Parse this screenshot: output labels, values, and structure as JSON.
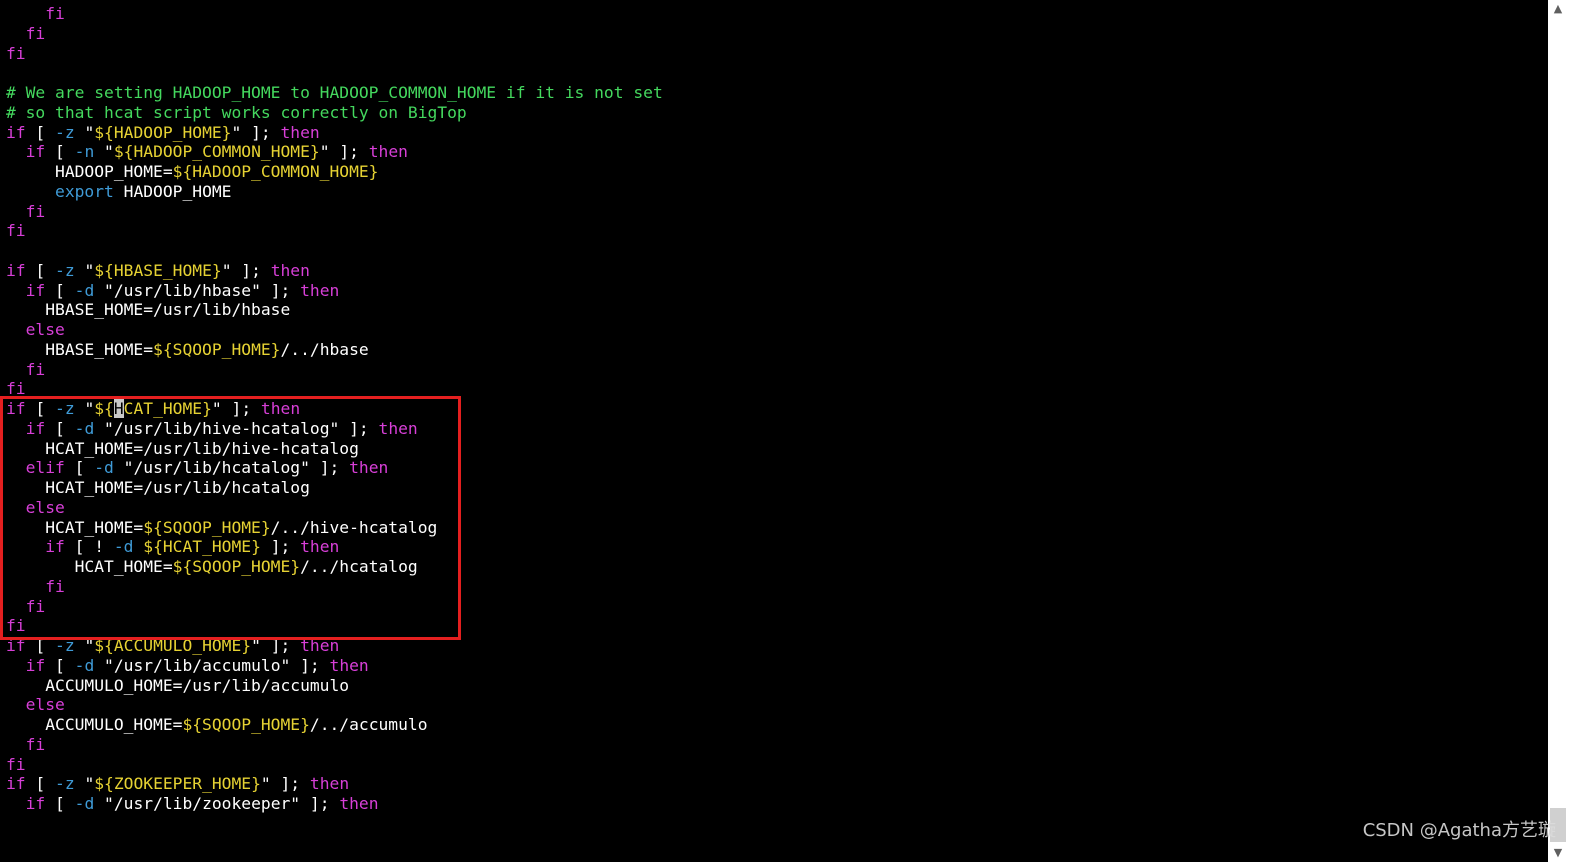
{
  "editor": {
    "lines": [
      [
        {
          "t": "    "
        },
        {
          "t": "fi",
          "c": "kw"
        }
      ],
      [
        {
          "t": "  "
        },
        {
          "t": "fi",
          "c": "kw"
        }
      ],
      [
        {
          "t": "fi",
          "c": "kw"
        }
      ],
      [],
      [
        {
          "t": "# We are setting HADOOP_HOME to HADOOP_COMMON_HOME if it is not set",
          "c": "cmt"
        }
      ],
      [
        {
          "t": "# so that hcat script works correctly on BigTop",
          "c": "cmt"
        }
      ],
      [
        {
          "t": "if",
          "c": "kw"
        },
        {
          "t": " [ "
        },
        {
          "t": "-z",
          "c": "cmd"
        },
        {
          "t": " \""
        },
        {
          "t": "${HADOOP_HOME}",
          "c": "var"
        },
        {
          "t": "\" ]; "
        },
        {
          "t": "then",
          "c": "kw"
        }
      ],
      [
        {
          "t": "  "
        },
        {
          "t": "if",
          "c": "kw"
        },
        {
          "t": " [ "
        },
        {
          "t": "-n",
          "c": "cmd"
        },
        {
          "t": " \""
        },
        {
          "t": "${HADOOP_COMMON_HOME}",
          "c": "var"
        },
        {
          "t": "\" ]; "
        },
        {
          "t": "then",
          "c": "kw"
        }
      ],
      [
        {
          "t": "     HADOOP_HOME="
        },
        {
          "t": "${HADOOP_COMMON_HOME}",
          "c": "var"
        }
      ],
      [
        {
          "t": "     "
        },
        {
          "t": "export",
          "c": "cmd"
        },
        {
          "t": " HADOOP_HOME"
        }
      ],
      [
        {
          "t": "  "
        },
        {
          "t": "fi",
          "c": "kw"
        }
      ],
      [
        {
          "t": "fi",
          "c": "kw"
        }
      ],
      [],
      [
        {
          "t": "if",
          "c": "kw"
        },
        {
          "t": " [ "
        },
        {
          "t": "-z",
          "c": "cmd"
        },
        {
          "t": " \""
        },
        {
          "t": "${HBASE_HOME}",
          "c": "var"
        },
        {
          "t": "\" ]; "
        },
        {
          "t": "then",
          "c": "kw"
        }
      ],
      [
        {
          "t": "  "
        },
        {
          "t": "if",
          "c": "kw"
        },
        {
          "t": " [ "
        },
        {
          "t": "-d",
          "c": "cmd"
        },
        {
          "t": " \"/usr/lib/hbase\" ]; "
        },
        {
          "t": "then",
          "c": "kw"
        }
      ],
      [
        {
          "t": "    HBASE_HOME=/usr/lib/hbase"
        }
      ],
      [
        {
          "t": "  "
        },
        {
          "t": "else",
          "c": "kw"
        }
      ],
      [
        {
          "t": "    HBASE_HOME="
        },
        {
          "t": "${SQOOP_HOME}",
          "c": "var"
        },
        {
          "t": "/../hbase"
        }
      ],
      [
        {
          "t": "  "
        },
        {
          "t": "fi",
          "c": "kw"
        }
      ],
      [
        {
          "t": "fi",
          "c": "kw"
        }
      ],
      [
        {
          "t": "if",
          "c": "kw"
        },
        {
          "t": " [ "
        },
        {
          "t": "-z",
          "c": "cmd"
        },
        {
          "t": " \""
        },
        {
          "t": "${",
          "c": "var"
        },
        {
          "t": "H",
          "c": "cursor"
        },
        {
          "t": "CAT_HOME}",
          "c": "var"
        },
        {
          "t": "\" ]; "
        },
        {
          "t": "then",
          "c": "kw"
        }
      ],
      [
        {
          "t": "  "
        },
        {
          "t": "if",
          "c": "kw"
        },
        {
          "t": " [ "
        },
        {
          "t": "-d",
          "c": "cmd"
        },
        {
          "t": " \"/usr/lib/hive-hcatalog\" ]; "
        },
        {
          "t": "then",
          "c": "kw"
        }
      ],
      [
        {
          "t": "    HCAT_HOME=/usr/lib/hive-hcatalog"
        }
      ],
      [
        {
          "t": "  "
        },
        {
          "t": "elif",
          "c": "kw"
        },
        {
          "t": " [ "
        },
        {
          "t": "-d",
          "c": "cmd"
        },
        {
          "t": " \"/usr/lib/hcatalog\" ]; "
        },
        {
          "t": "then",
          "c": "kw"
        }
      ],
      [
        {
          "t": "    HCAT_HOME=/usr/lib/hcatalog"
        }
      ],
      [
        {
          "t": "  "
        },
        {
          "t": "else",
          "c": "kw"
        }
      ],
      [
        {
          "t": "    HCAT_HOME="
        },
        {
          "t": "${SQOOP_HOME}",
          "c": "var"
        },
        {
          "t": "/../hive-hcatalog"
        }
      ],
      [
        {
          "t": "    "
        },
        {
          "t": "if",
          "c": "kw"
        },
        {
          "t": " [ ! "
        },
        {
          "t": "-d",
          "c": "cmd"
        },
        {
          "t": " "
        },
        {
          "t": "${HCAT_HOME}",
          "c": "var"
        },
        {
          "t": " ]; "
        },
        {
          "t": "then",
          "c": "kw"
        }
      ],
      [
        {
          "t": "       HCAT_HOME="
        },
        {
          "t": "${SQOOP_HOME}",
          "c": "var"
        },
        {
          "t": "/../hcatalog"
        }
      ],
      [
        {
          "t": "    "
        },
        {
          "t": "fi",
          "c": "kw"
        }
      ],
      [
        {
          "t": "  "
        },
        {
          "t": "fi",
          "c": "kw"
        }
      ],
      [
        {
          "t": "fi",
          "c": "kw"
        }
      ],
      [
        {
          "t": "if",
          "c": "kw"
        },
        {
          "t": " [ "
        },
        {
          "t": "-z",
          "c": "cmd"
        },
        {
          "t": " \""
        },
        {
          "t": "${ACCUMULO_HOME}",
          "c": "var"
        },
        {
          "t": "\" ]; "
        },
        {
          "t": "then",
          "c": "kw"
        }
      ],
      [
        {
          "t": "  "
        },
        {
          "t": "if",
          "c": "kw"
        },
        {
          "t": " [ "
        },
        {
          "t": "-d",
          "c": "cmd"
        },
        {
          "t": " \"/usr/lib/accumulo\" ]; "
        },
        {
          "t": "then",
          "c": "kw"
        }
      ],
      [
        {
          "t": "    ACCUMULO_HOME=/usr/lib/accumulo"
        }
      ],
      [
        {
          "t": "  "
        },
        {
          "t": "else",
          "c": "kw"
        }
      ],
      [
        {
          "t": "    ACCUMULO_HOME="
        },
        {
          "t": "${SQOOP_HOME}",
          "c": "var"
        },
        {
          "t": "/../accumulo"
        }
      ],
      [
        {
          "t": "  "
        },
        {
          "t": "fi",
          "c": "kw"
        }
      ],
      [
        {
          "t": "fi",
          "c": "kw"
        }
      ],
      [
        {
          "t": "if",
          "c": "kw"
        },
        {
          "t": " [ "
        },
        {
          "t": "-z",
          "c": "cmd"
        },
        {
          "t": " \""
        },
        {
          "t": "${ZOOKEEPER_HOME}",
          "c": "var"
        },
        {
          "t": "\" ]; "
        },
        {
          "t": "then",
          "c": "kw"
        }
      ],
      [
        {
          "t": "  "
        },
        {
          "t": "if",
          "c": "kw"
        },
        {
          "t": " [ "
        },
        {
          "t": "-d",
          "c": "cmd"
        },
        {
          "t": " \"/usr/lib/zookeeper\" ]; "
        },
        {
          "t": "then",
          "c": "kw"
        }
      ]
    ]
  },
  "scrollbar": {
    "up_glyph": "▲",
    "down_glyph": "▼"
  },
  "watermark": "CSDN @Agatha方艺璇",
  "colors": {
    "background": "#000000",
    "keyword": "#d73fd7",
    "command": "#3f9bd7",
    "variable": "#e6d233",
    "comment": "#44d85e",
    "text": "#ffffff",
    "highlight_box": "#e41f1f"
  }
}
